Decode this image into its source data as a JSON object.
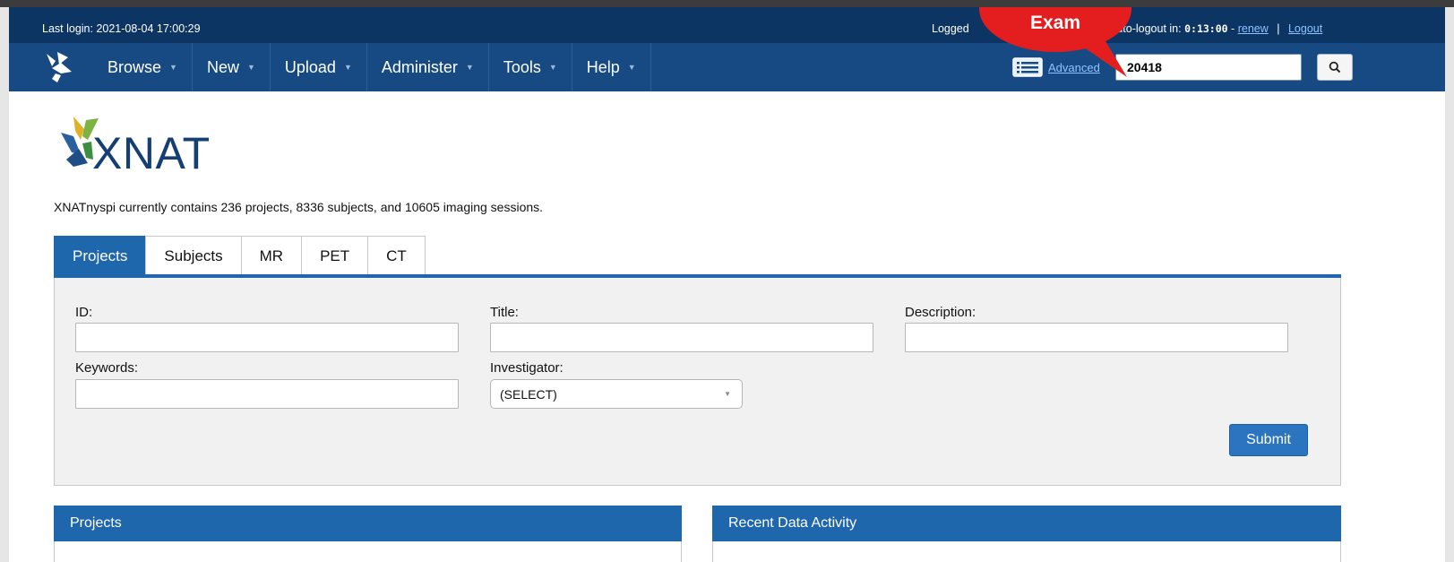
{
  "header": {
    "last_login": "Last login: 2021-08-04 17:00:29",
    "logged_in_partial": "Logged",
    "autologout_label": "Auto-logout in:",
    "autologout_time": "0:13:00",
    "renew": "renew",
    "separator": "|",
    "logout": "Logout",
    "dash": "-"
  },
  "nav": {
    "items": [
      {
        "label": "Browse"
      },
      {
        "label": "New"
      },
      {
        "label": "Upload"
      },
      {
        "label": "Administer"
      },
      {
        "label": "Tools"
      },
      {
        "label": "Help"
      }
    ],
    "advanced_label": "Advanced",
    "search_value": "20418"
  },
  "callout": {
    "text": "Exam",
    "color": "#e41e1f"
  },
  "logo": {
    "text": "XNAT"
  },
  "stats": "XNATnyspi currently contains 236 projects, 8336 subjects, and 10605 imaging sessions.",
  "tabs": [
    "Projects",
    "Subjects",
    "MR",
    "PET",
    "CT"
  ],
  "active_tab": "Projects",
  "form": {
    "id_label": "ID:",
    "title_label": "Title:",
    "description_label": "Description:",
    "keywords_label": "Keywords:",
    "investigator_label": "Investigator:",
    "investigator_value": "(SELECT)",
    "submit_label": "Submit"
  },
  "panels": {
    "projects_title": "Projects",
    "activity_title": "Recent Data Activity"
  },
  "colors": {
    "header_dark": "#0c3563",
    "nav_blue": "#174a82",
    "accent_blue": "#1f67ad"
  }
}
